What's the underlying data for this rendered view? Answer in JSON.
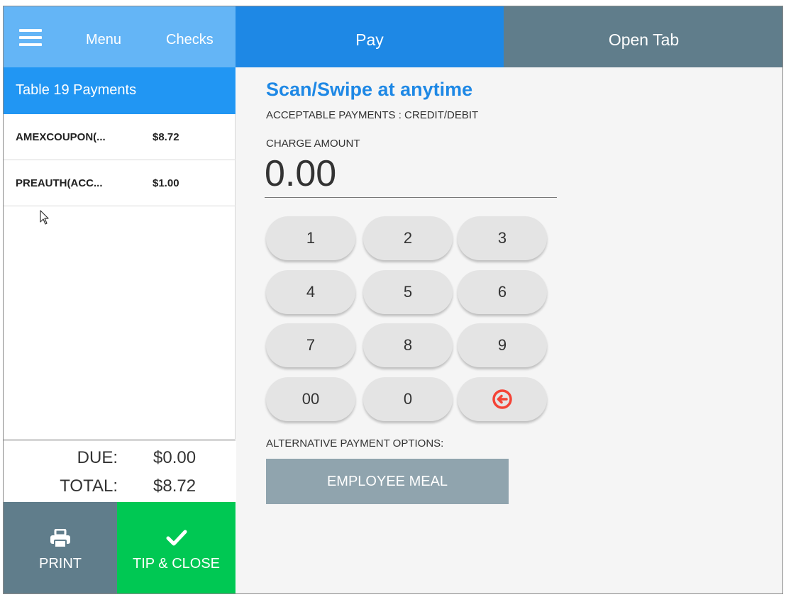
{
  "header": {
    "menu_icon": "hamburger-menu-icon",
    "menu_label": "Menu",
    "checks_label": "Checks"
  },
  "tabs": [
    {
      "label": "Pay",
      "active": true,
      "color": "#1e88e5"
    },
    {
      "label": "Open Tab",
      "active": false,
      "color": "#607d8b"
    }
  ],
  "sidebar": {
    "title": "Table 19 Payments",
    "payments": [
      {
        "name": "AMEXCOUPON(...",
        "amount": "$8.72"
      },
      {
        "name": "PREAUTH(ACC...",
        "amount": "$1.00"
      }
    ],
    "due_label": "DUE:",
    "due_value": "$0.00",
    "total_label": "TOTAL:",
    "total_value": "$8.72",
    "print_label": "PRINT",
    "print_icon": "printer-icon",
    "tip_close_label": "TIP & CLOSE",
    "tip_close_icon": "checkmark-icon"
  },
  "payment": {
    "title": "Scan/Swipe at anytime",
    "acceptable": "ACCEPTABLE PAYMENTS : CREDIT/DEBIT",
    "charge_label": "CHARGE AMOUNT",
    "charge_amount": "0.00",
    "keys": [
      "1",
      "2",
      "3",
      "4",
      "5",
      "6",
      "7",
      "8",
      "9",
      "00",
      "0"
    ],
    "backspace_icon": "backspace-circle-icon",
    "alt_label": "ALTERNATIVE PAYMENT OPTIONS:",
    "employee_meal_label": "EMPLOYEE MEAL"
  },
  "colors": {
    "header_light_blue": "#64b5f6",
    "accent_blue": "#1e88e5",
    "slate": "#607d8b",
    "green": "#00c853",
    "backspace_red": "#f44336"
  }
}
